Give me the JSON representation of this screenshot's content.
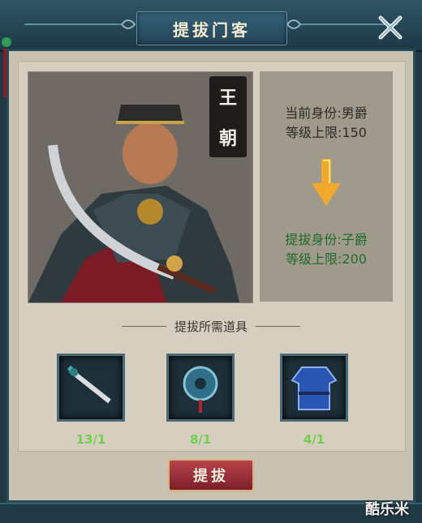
{
  "dialog": {
    "title": "提拔门客",
    "close_icon": "close-x-icon"
  },
  "hero": {
    "name_chars": [
      "王",
      "朝"
    ]
  },
  "current": {
    "rank": "当前身份:男爵",
    "level_cap": "等级上限:150"
  },
  "next": {
    "rank": "提拔身份:子爵",
    "level_cap": "等级上限:200"
  },
  "section_label": "提拔所需道具",
  "items": [
    {
      "icon": "sword-item-icon",
      "count": "13/1"
    },
    {
      "icon": "jade-pendant-item-icon",
      "count": "8/1"
    },
    {
      "icon": "blue-robe-item-icon",
      "count": "4/1"
    }
  ],
  "promote_button": "提拔",
  "watermark": "酷乐米",
  "colors": {
    "accent_green": "#6ed04d",
    "next_rank_green": "#1f6b2b",
    "button_red": "#9a2e37",
    "header_blue": "#2f5566"
  }
}
